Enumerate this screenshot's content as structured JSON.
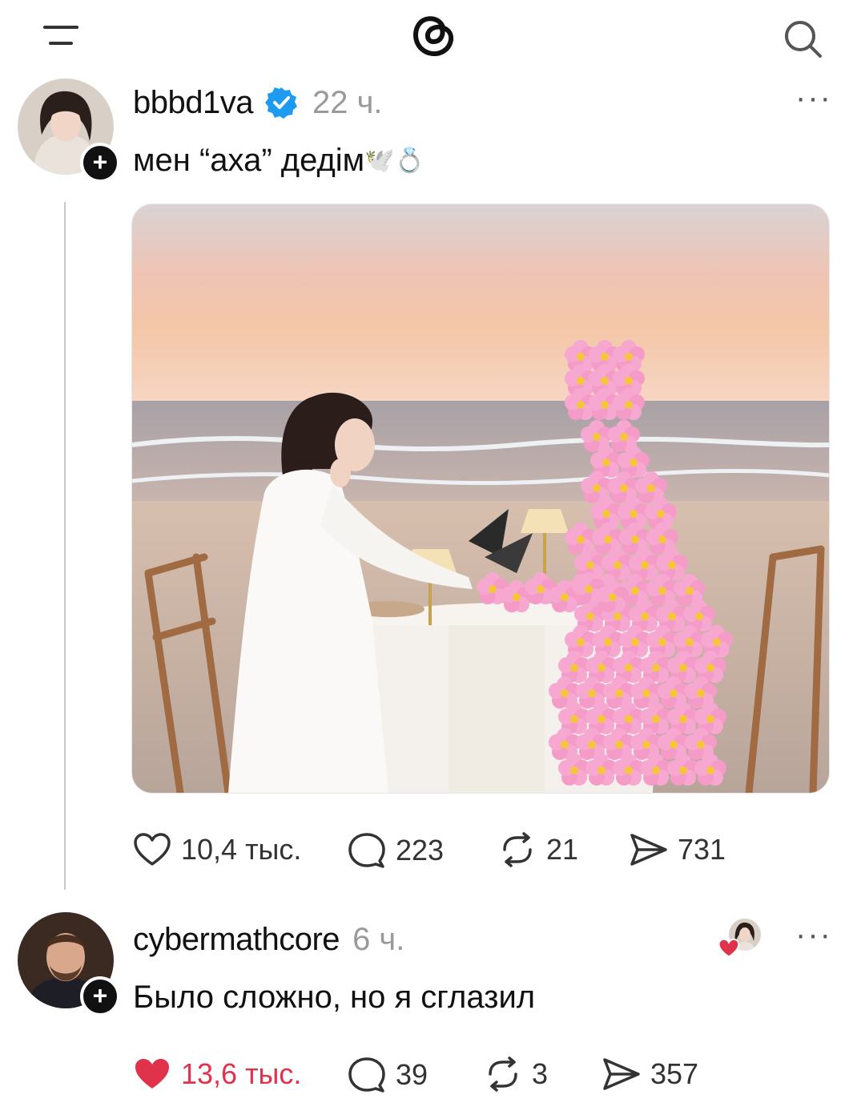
{
  "header": {
    "menu_icon": "menu-icon",
    "logo_icon": "threads-logo-icon",
    "search_icon": "search-icon"
  },
  "post": {
    "username": "bbbd1va",
    "verified_icon": "verified-badge-icon",
    "timestamp": "22 ч.",
    "text": "мен “аха” дедім",
    "text_emoji": "🕊️💍",
    "more_label": "···",
    "actions": {
      "likes": "10,4 тыс.",
      "comments": "223",
      "reposts": "21",
      "shares": "731"
    }
  },
  "reply": {
    "username": "cybermathcore",
    "timestamp": "6 ч.",
    "text": "Было сложно, но я сглазил",
    "more_label": "···",
    "liked_by_author_icon": "liked-by-author-icon",
    "actions": {
      "likes": "13,6 тыс.",
      "liked": true,
      "comments": "39",
      "reposts": "3",
      "shares": "357"
    }
  },
  "colors": {
    "verified": "#1d9bf0",
    "liked": "#e0334b",
    "secondary_text": "#9a9a9a"
  }
}
